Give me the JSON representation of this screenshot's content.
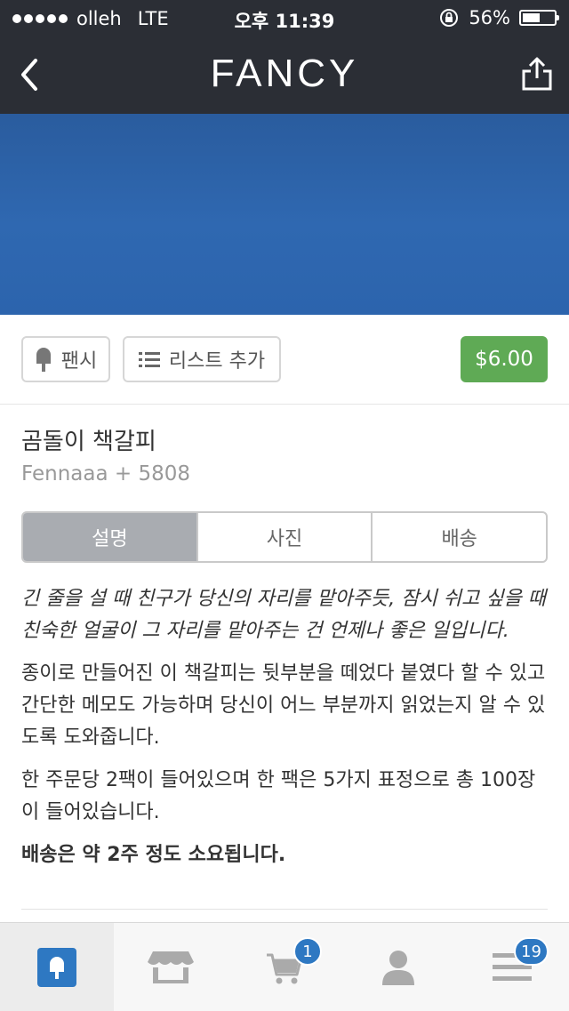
{
  "status": {
    "carrier": "olleh",
    "network": "LTE",
    "time": "오후 11:39",
    "battery_text": "56%",
    "battery_level": 0.56
  },
  "nav": {
    "title": "FANCY",
    "back_icon": "chevron-left-icon",
    "share_icon": "share-icon"
  },
  "actions": {
    "fancy_label": "팬시",
    "list_label": "리스트 추가",
    "price": "$6.00"
  },
  "product": {
    "title": "곰돌이 책갈피",
    "meta": "Fennaaa + 5808"
  },
  "tabs": [
    {
      "label": "설명"
    },
    {
      "label": "사진"
    },
    {
      "label": "배송"
    }
  ],
  "description": {
    "p1": "긴 줄을 설 때 친구가 당신의 자리를 맡아주듯, 잠시 쉬고 싶을 때 친숙한 얼굴이 그 자리를 맡아주는 건 언제나 좋은 일입니다.",
    "p2": "종이로 만들어진 이 책갈피는 뒷부분을 떼었다 붙였다 할 수 있고 간단한 메모도 가능하며 당신이 어느 부분까지 읽었는지 알 수 있도록 도와줍니다.",
    "p3": "한 주문당 2팩이 들어있으며 한 팩은 5가지 표정으로 총 100장이 들어있습니다.",
    "p4": "배송은 약 2주 정도 소요됩니다."
  },
  "tabbar": {
    "cart_badge": "1",
    "menu_badge": "19"
  },
  "colors": {
    "nav_bg": "#2b2e35",
    "accent": "#2e78c2",
    "price_bg": "#5faa55"
  }
}
